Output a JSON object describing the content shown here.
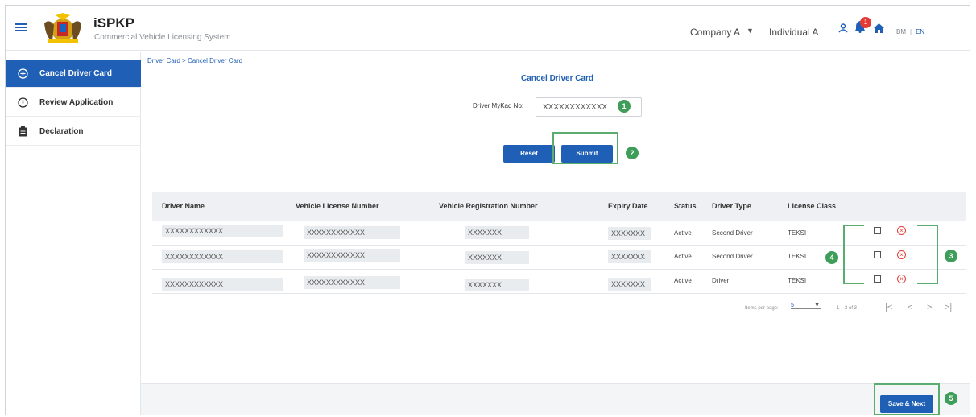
{
  "header": {
    "app_name": "iSPKP",
    "app_subtitle": "Commercial Vehicle Licensing System",
    "company": "Company A",
    "individual": "Individual A",
    "notification_count": "1",
    "lang_bm": "BM",
    "lang_sep": "|",
    "lang_en": "EN"
  },
  "sidebar": {
    "items": [
      {
        "label": "Cancel Driver Card",
        "icon": "plus-circle-icon",
        "active": true
      },
      {
        "label": "Review Application",
        "icon": "info-circle-icon",
        "active": false
      },
      {
        "label": "Declaration",
        "icon": "clipboard-icon",
        "active": false
      }
    ]
  },
  "breadcrumb": "Driver Card > Cancel Driver Card",
  "form": {
    "title": "Cancel Driver Card",
    "mykad_label": "Driver MyKad No:",
    "mykad_value": "XXXXXXXXXXXX",
    "reset_label": "Reset",
    "submit_label": "Submit"
  },
  "table": {
    "headers": [
      "Driver Name",
      "Vehicle License Number",
      "Vehicle Registration Number",
      "Expiry Date",
      "Status",
      "Driver Type",
      "License Class"
    ],
    "rows": [
      [
        "XXXXXXXXXXXX",
        "XXXXXXXXXXXX",
        "XXXXXXX",
        "XXXXXXX",
        "Active",
        "Second Driver",
        "TEKSI"
      ],
      [
        "XXXXXXXXXXXX",
        "XXXXXXXXXXXX",
        "XXXXXXX",
        "XXXXXXX",
        "Active",
        "Second Driver",
        "TEKSI"
      ],
      [
        "XXXXXXXXXXXX",
        "XXXXXXXXXXXX",
        "XXXXXXX",
        "XXXXXXX",
        "Active",
        "Driver",
        "TEKSI"
      ]
    ]
  },
  "pagination": {
    "items_per_page_label": "Items per page:",
    "items_per_page_value": "5",
    "range": "1 – 3 of 3"
  },
  "steps": [
    "1",
    "2",
    "3",
    "4",
    "5"
  ],
  "footer": {
    "save_next_label": "Save & Next"
  },
  "colors": {
    "primary": "#1f5fb5",
    "annotation_green": "#3f9d5a",
    "danger": "#e53935"
  }
}
